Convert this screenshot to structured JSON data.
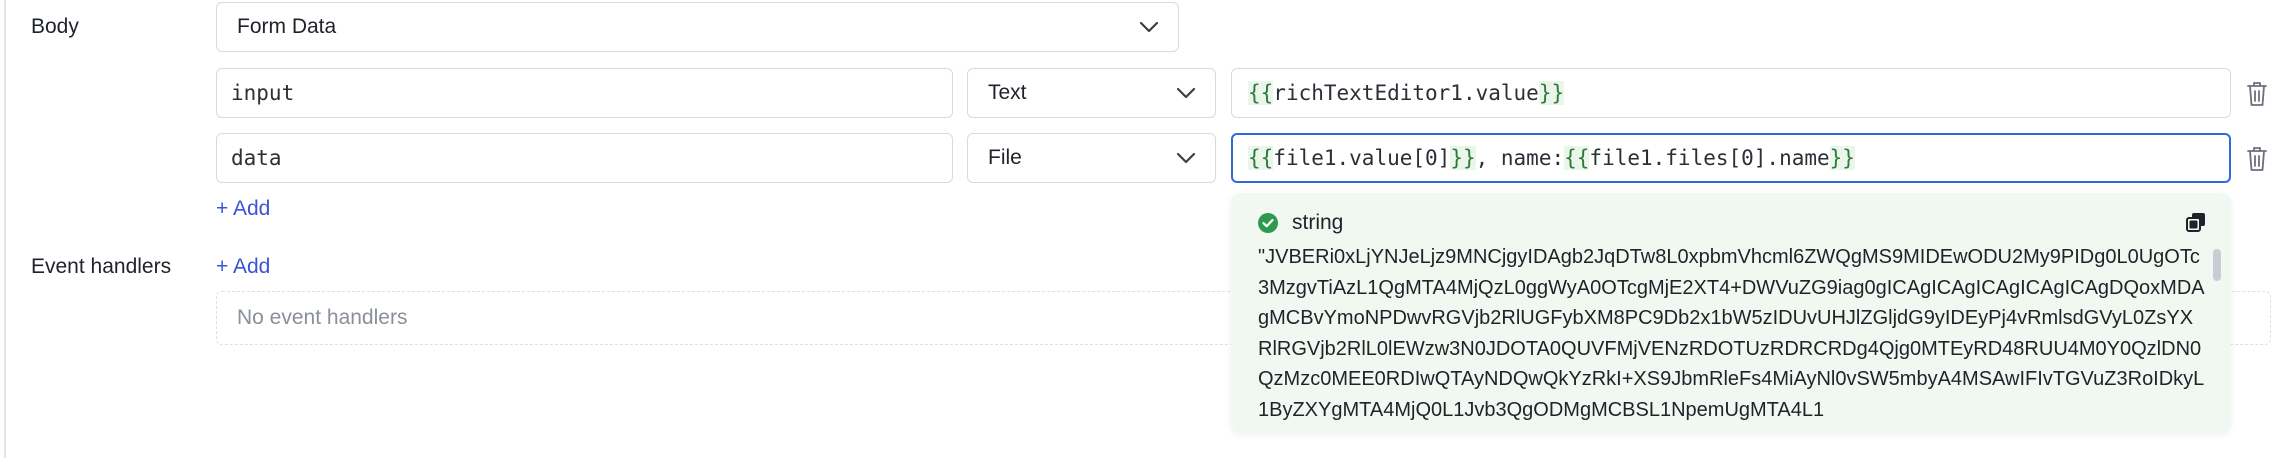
{
  "body_section": {
    "label": "Body",
    "type_value": "Form Data"
  },
  "params": [
    {
      "key": "input",
      "type": "Text",
      "value_parts": [
        "{{",
        "richTextEditor1.value",
        "}}"
      ]
    },
    {
      "key": "data",
      "type": "File",
      "value_parts": [
        "{{",
        "file1.value[0]",
        "}}",
        ", name: ",
        "{{",
        "file1.files[0].name",
        "}}"
      ]
    }
  ],
  "add_label": "+ Add",
  "event_section": {
    "label": "Event handlers",
    "add_label": "+ Add",
    "empty_text": "No event handlers"
  },
  "popup": {
    "type_label": "string",
    "preview": "\"JVBERi0xLjYNJeLjz9MNCjgyIDAgb2JqDTw8L0xpbmVhcml6ZWQgMS9MIDEwODU2My9PIDg0L0UgOTc3MzgvTiAzL1QgMTA4MjQzL0ggWyA0OTcgMjE2XT4+DWVuZG9iag0gICAgICAgICAgICAgICAgDQoxMDAgMCBvYmoNPDwvRGVjb2RlUGFybXM8PC9Db2x1bW5zIDUvUHJlZGljdG9yIDEyPj4vRmlsdGVyL0ZsYXRlRGVjb2RlL0lEWzw3N0JDOTA0QUVFMjVENzRDOTUzRDRCRDg4Qjg0MTEyRD48RUU4M0Y0QzlDN0QzMzc0MEE0RDIwQTAyNDQwQkYzRkI+XS9JbmRleFs4MiAyNl0vSW5mbyA4MSAwIFIvTGVuZ3RoIDkyL1ByZXYgMTA4MjQ0L1Jvb3QgODMgMCBSL1NpemUgMTA4L1",
    "accent": "#2d9a4f"
  },
  "colors": {
    "focus": "#2e6bd8",
    "link": "#3a55d4",
    "brace": "#2f7a3d"
  }
}
